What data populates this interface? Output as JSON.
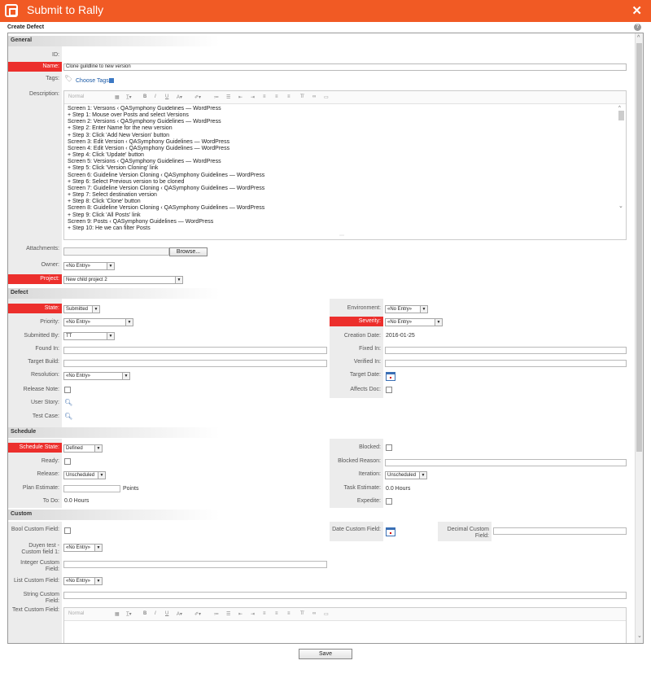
{
  "window": {
    "title": "Submit to Rally",
    "close": "✕"
  },
  "form_title": "Create Defect",
  "help": "?",
  "sections": {
    "general": "General",
    "defect": "Defect",
    "schedule": "Schedule",
    "custom": "Custom"
  },
  "general": {
    "id_label": "ID:",
    "name_label": "Name:",
    "name_value": "Clone guildline to new version",
    "tags_label": "Tags:",
    "choose_tags": "Choose Tags",
    "description_label": "Description:",
    "style_placeholder": "Normal",
    "description_lines": [
      "Screen 1: Versions ‹ QASymphony Guidelines — WordPress",
      "+ Step 1: Mouse over Posts and select Versions",
      "Screen 2: Versions ‹ QASymphony Guidelines — WordPress",
      "+ Step 2: Enter Name for the new version",
      "+ Step 3: Click 'Add New Version' button",
      "Screen 3: Edit Version ‹ QASymphony Guidelines — WordPress",
      "Screen 4: Edit Version ‹ QASymphony Guidelines — WordPress",
      "+ Step 4: Click 'Update' button",
      "Screen 5: Versions ‹ QASymphony Guidelines — WordPress",
      "+ Step 5: Click 'Version Cloning' link",
      "Screen 6: Guideline Version Cloning ‹ QASymphony Guidelines — WordPress",
      "+ Step 6: Select Previous version to be cloned",
      "Screen 7: Guideline Version Cloning ‹ QASymphony Guidelines — WordPress",
      "+ Step 7: Select destination version",
      "+ Step 8: Click 'Clone' button",
      "Screen 8: Guideline Version Cloning ‹ QASymphony Guidelines — WordPress",
      "+ Step 9: Click 'All Posts' link",
      "Screen 9: Posts ‹ QASymphony Guidelines — WordPress",
      "+ Step 10: He we can filter Posts"
    ],
    "attachments_label": "Attachments:",
    "browse": "Browse...",
    "owner_label": "Owner:",
    "owner_value": "«No Entry»",
    "project_label": "Project:",
    "project_value": "New child project 2"
  },
  "defect": {
    "state_label": "State:",
    "state_value": "Submitted",
    "priority_label": "Priority:",
    "priority_value": "«No Entry»",
    "submitted_by_label": "Submitted By:",
    "submitted_by_value": "TT",
    "found_in_label": "Found In:",
    "target_build_label": "Target Build:",
    "resolution_label": "Resolution:",
    "resolution_value": "«No Entry»",
    "release_note_label": "Release Note:",
    "user_story_label": "User Story:",
    "test_case_label": "Test Case:",
    "environment_label": "Environment:",
    "environment_value": "«No Entry»",
    "severity_label": "Severity:",
    "severity_value": "«No Entry»",
    "creation_date_label": "Creation Date:",
    "creation_date_value": "2016-01-25",
    "fixed_in_label": "Fixed In:",
    "verified_in_label": "Verified In:",
    "target_date_label": "Target Date:",
    "affects_doc_label": "Affects Doc:"
  },
  "schedule": {
    "schedule_state_label": "Schedule State:",
    "schedule_state_value": "Defined",
    "ready_label": "Ready:",
    "release_label": "Release:",
    "release_value": "Unscheduled",
    "plan_estimate_label": "Plan Estimate:",
    "points": "Points",
    "todo_label": "To Do:",
    "todo_value": "0.0 Hours",
    "blocked_label": "Blocked:",
    "blocked_reason_label": "Blocked Reason:",
    "iteration_label": "Iteration:",
    "iteration_value": "Unscheduled",
    "task_estimate_label": "Task Estimate:",
    "task_estimate_value": "0.0 Hours",
    "expedite_label": "Expedite:"
  },
  "custom": {
    "bool_label": "Bool Custom Field:",
    "duyen_label": "Duyen test - Custom field 1:",
    "duyen_value": "«No Entry»",
    "integer_label": "Integer Custom Field:",
    "list_label": "List Custom Field:",
    "list_value": "«No Entry»",
    "string_label": "String Custom Field:",
    "text_label": "Text Custom Field:",
    "date_label": "Date Custom Field:",
    "decimal_label": "Decimal Custom Field:"
  },
  "save": "Save",
  "colors": {
    "titlebar": "#f15a24",
    "required": "#ec2f2c"
  }
}
